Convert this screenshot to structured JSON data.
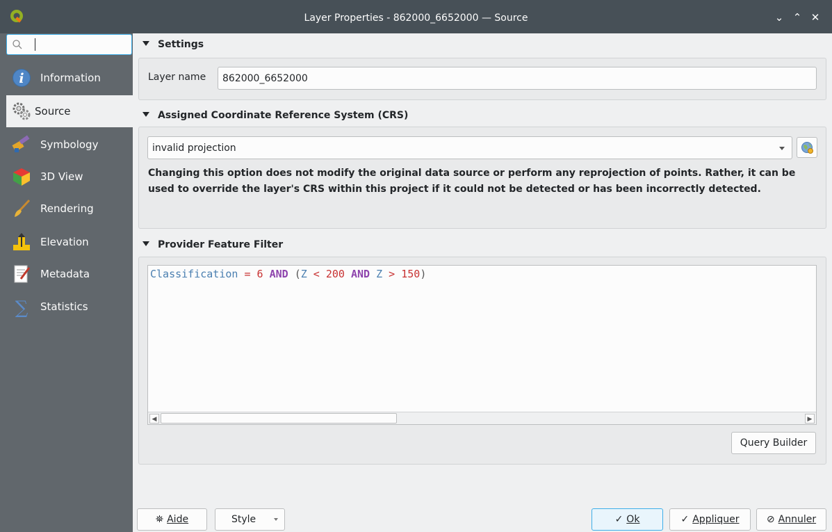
{
  "window": {
    "title": "Layer Properties - 862000_6652000 — Source",
    "controls": [
      "⌄",
      "⌃",
      "✕"
    ]
  },
  "sidebar": {
    "search": {
      "value": "",
      "placeholder": ""
    },
    "items": [
      {
        "label": "Information",
        "icon": "information-icon"
      },
      {
        "label": "Source",
        "icon": "source-icon",
        "active": true
      },
      {
        "label": "Symbology",
        "icon": "symbology-icon"
      },
      {
        "label": "3D View",
        "icon": "3d-view-icon"
      },
      {
        "label": "Rendering",
        "icon": "rendering-icon"
      },
      {
        "label": "Elevation",
        "icon": "elevation-icon"
      },
      {
        "label": "Metadata",
        "icon": "metadata-icon"
      },
      {
        "label": "Statistics",
        "icon": "statistics-icon"
      }
    ]
  },
  "settings": {
    "header": "Settings",
    "layer_name_label": "Layer name",
    "layer_name_value": "862000_6652000"
  },
  "crs": {
    "header": "Assigned Coordinate Reference System (CRS)",
    "selected": "invalid projection",
    "info": "Changing this option does not modify the original data source or perform any reprojection of points. Rather, it can be used to override the layer's CRS within this project if it could not be detected or has been incorrectly detected."
  },
  "filter": {
    "header": "Provider Feature Filter",
    "expression_tokens": [
      {
        "t": "Classification",
        "k": "field"
      },
      {
        "t": " = ",
        "k": "op"
      },
      {
        "t": "6",
        "k": "num"
      },
      {
        "t": " AND ",
        "k": "kw"
      },
      {
        "t": "(",
        "k": "paren"
      },
      {
        "t": "Z",
        "k": "field"
      },
      {
        "t": " < ",
        "k": "op"
      },
      {
        "t": "200",
        "k": "num"
      },
      {
        "t": " AND ",
        "k": "kw"
      },
      {
        "t": "Z",
        "k": "field"
      },
      {
        "t": " > ",
        "k": "op"
      },
      {
        "t": "150",
        "k": "num"
      },
      {
        "t": ")",
        "k": "paren"
      }
    ],
    "query_builder_label": "Query Builder"
  },
  "footer": {
    "help_label": "Aide",
    "style_label": "Style",
    "ok_label": "Ok",
    "apply_label": "Appliquer",
    "cancel_label": "Annuler"
  },
  "colors": {
    "titlebar": "#475057",
    "sidebar": "#61676c",
    "accent": "#3daee9"
  }
}
